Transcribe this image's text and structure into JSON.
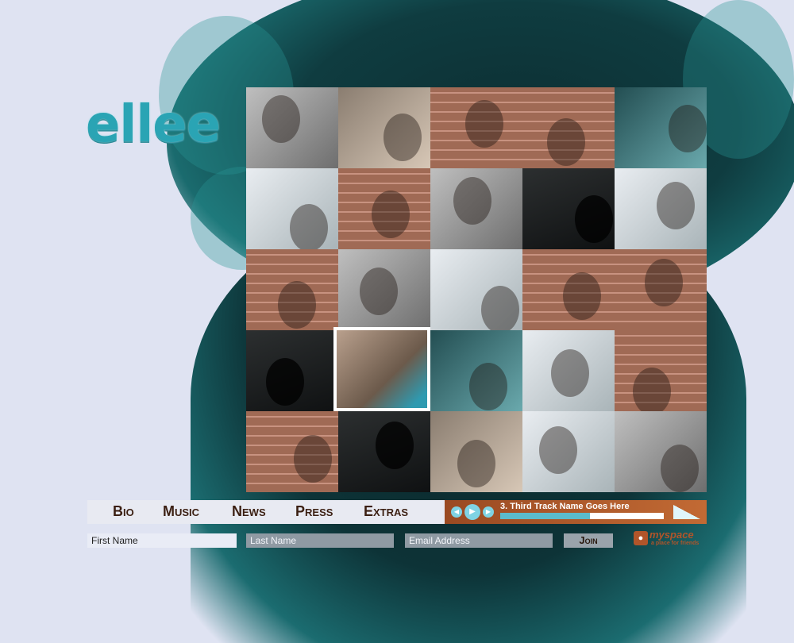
{
  "brand": {
    "logo_text": "ellee"
  },
  "nav": {
    "items": [
      "Bio",
      "Music",
      "News",
      "Press",
      "Extras"
    ]
  },
  "player": {
    "track_title": "3. Third Track Name Goes Here",
    "progress_fraction": 0.55,
    "icons": [
      "prev-icon",
      "play-icon",
      "next-icon",
      "volume-icon"
    ]
  },
  "signup": {
    "first_placeholder": "First Name",
    "last_placeholder": "Last Name",
    "email_placeholder": "Email Address",
    "join_label": "Join"
  },
  "myspace": {
    "wordmark": "myspace",
    "tagline": "a place for friends"
  },
  "gallery": {
    "tiles": [
      "gray",
      "tan",
      "brick",
      "brick",
      "teal",
      "light",
      "brick",
      "gray",
      "dark",
      "light",
      "brick",
      "gray",
      "light",
      "brick",
      "brick",
      "dark",
      "selected",
      "teal",
      "light",
      "brick",
      "brick",
      "dark",
      "tan",
      "light",
      "gray"
    ]
  },
  "colors": {
    "background": "#dfe3f2",
    "accent_teal": "#2aa4b4",
    "nav_text": "#3b1f12",
    "player_bg": "#c26a34"
  }
}
